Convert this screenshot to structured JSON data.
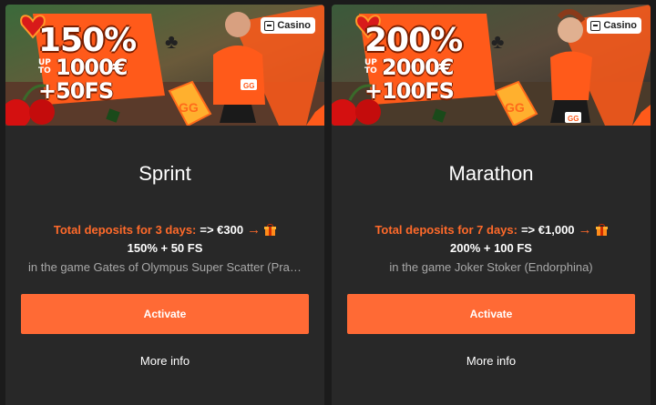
{
  "colors": {
    "accent": "#ff6a35",
    "label_orange": "#ff6a2a",
    "card_bg": "#282828",
    "page_bg": "#1b1b1b"
  },
  "cards": [
    {
      "banner": {
        "percent": "150%",
        "upto": "UP TO",
        "amount": "1000€",
        "freespins": "+50FS",
        "tag": "Casino",
        "tag_icon": "slot-machine-icon"
      },
      "title": "Sprint",
      "deposit_label": "Total deposits for 3 days:",
      "deposit_value": "=> €300",
      "arrow": "→",
      "gift_icon": "gift-icon",
      "bonus": "150% + 50 FS",
      "game": "in the game Gates of Olympus Super Scatter (Pragmatic Play)",
      "activate": "Activate",
      "more_info": "More info"
    },
    {
      "banner": {
        "percent": "200%",
        "upto": "UP TO",
        "amount": "2000€",
        "freespins": "+100FS",
        "tag": "Casino",
        "tag_icon": "slot-machine-icon"
      },
      "title": "Marathon",
      "deposit_label": "Total deposits for 7 days:",
      "deposit_value": "=> €1,000",
      "arrow": "→",
      "gift_icon": "gift-icon",
      "bonus": "200% + 100 FS",
      "game": "in the game Joker Stoker (Endorphina)",
      "activate": "Activate",
      "more_info": "More info"
    }
  ]
}
